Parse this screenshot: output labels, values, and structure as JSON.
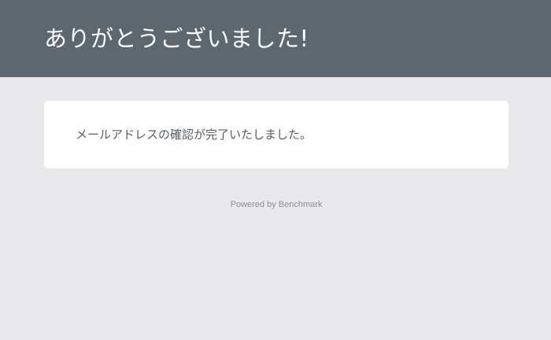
{
  "header": {
    "title": "ありがとうございました!"
  },
  "card": {
    "message": "メールアドレスの確認が完了いたしました。"
  },
  "footer": {
    "powered_by": "Powered by Benchmark"
  },
  "colors": {
    "header_bg": "#5c6770",
    "page_bg": "#e9e9eb",
    "card_bg": "#ffffff",
    "message_text": "#555d62",
    "footer_text": "#8b8f93"
  }
}
